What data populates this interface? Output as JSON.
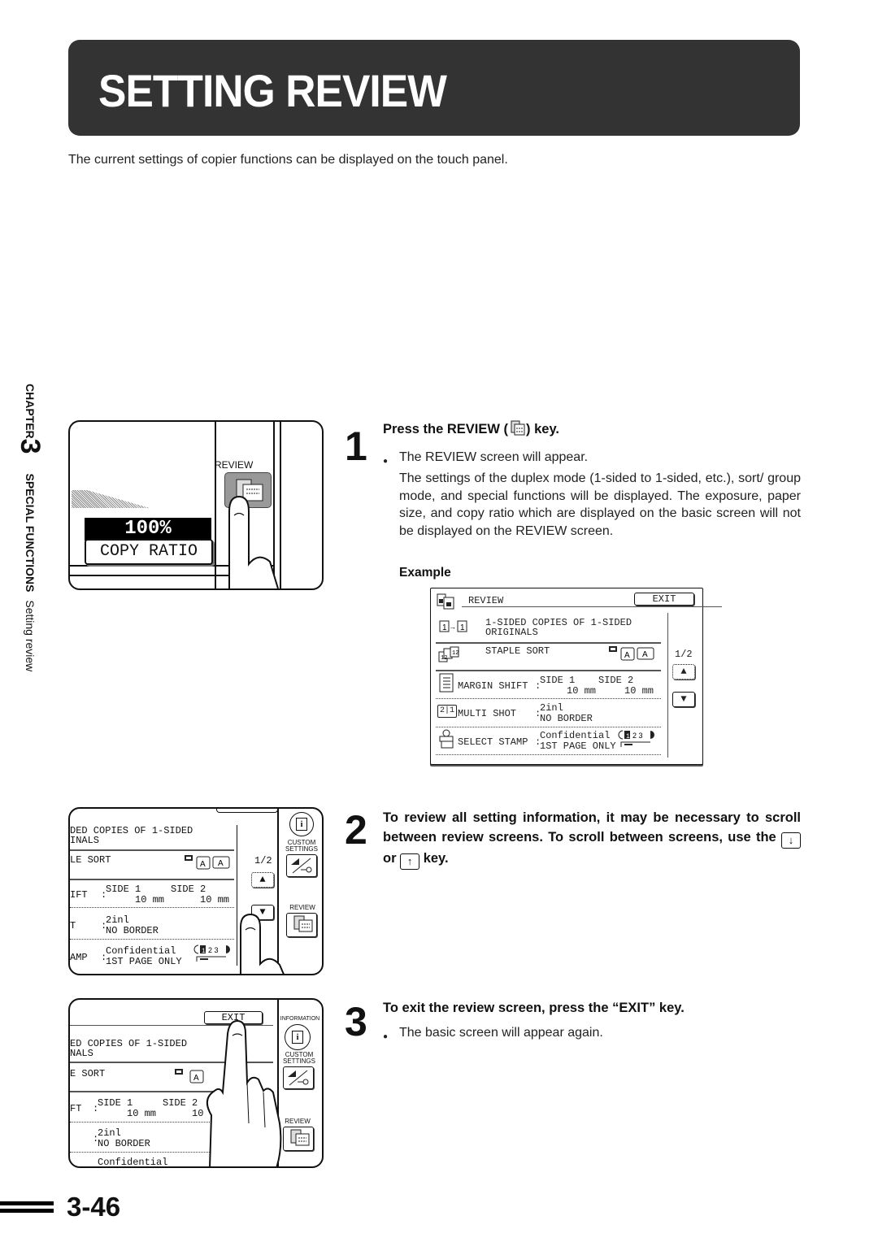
{
  "page": {
    "title": "SETTING REVIEW",
    "intro": "The current settings of copier functions can be displayed on the touch panel.",
    "side_label": {
      "chapter": "CHAPTER",
      "chapter_number": "3",
      "section": "SPECIAL FUNCTIONS",
      "subsection": "Setting review"
    },
    "page_number": "3-46"
  },
  "panel1": {
    "review_label": "REVIEW",
    "ratio_value": "100%",
    "ratio_label": "COPY RATIO",
    "review_icon": "review-key-icon"
  },
  "step1": {
    "number": "1",
    "heading_pre": "Press the REVIEW (",
    "heading_post": ") key.",
    "bullet": "The REVIEW screen will appear.",
    "paragraph": "The settings of the duplex mode (1-sided to 1-sided, etc.), sort/ group mode, and special functions will be displayed. The exposure, paper size, and copy ratio which are displayed on the basic screen will not be displayed on the REVIEW screen.",
    "example_label": "Example"
  },
  "example_screen": {
    "title": "REVIEW",
    "exit_label": "EXIT",
    "page_indicator": "1/2",
    "rows": [
      {
        "icon": "duplex-1-to-1-icon",
        "line1": "1-SIDED COPIES OF 1-SIDED",
        "line2": "ORIGINALS"
      },
      {
        "icon": "staple-sort-icon",
        "line1": "STAPLE SORT",
        "line2": ""
      },
      {
        "icon": "margin-shift-icon",
        "label": "MARGIN SHIFT",
        "side1": "SIDE 1",
        "side1_val": "10 mm",
        "side2": "SIDE 2",
        "side2_val": "10 mm"
      },
      {
        "icon": "multi-shot-icon",
        "label": "MULTI SHOT",
        "line1": "2inl",
        "line2": "NO BORDER"
      },
      {
        "icon": "select-stamp-icon",
        "label": "SELECT STAMP",
        "line1": "Confidential",
        "line2": "1ST PAGE ONLY",
        "stamp_pages": "1 2 3"
      }
    ],
    "multishot_digits": "2|1"
  },
  "step2": {
    "number": "2",
    "heading_pre": "To review all setting information, it may be necessary to scroll between review screens. To scroll between screens, use the",
    "heading_mid": "or",
    "heading_post": "key.",
    "down_key": "↓",
    "up_key": "↑"
  },
  "panel2": {
    "line1": "DED COPIES OF 1-SIDED",
    "line2": "INALS",
    "sort": "LE SORT",
    "shift_label": "IFT",
    "side1": "SIDE 1",
    "side1_val": "10 mm",
    "side2": "SIDE 2",
    "side2_val": "10 mm",
    "ms_label": "T",
    "ms1": "2inl",
    "ms2": "NO BORDER",
    "stamp_label": "AMP",
    "stamp1": "Confidential",
    "stamp2": "1ST PAGE ONLY",
    "page_indicator": "1/2",
    "custom_settings": "CUSTOM SETTINGS",
    "review": "REVIEW"
  },
  "step3": {
    "number": "3",
    "heading": "To exit the review screen, press the “EXIT” key.",
    "bullet": "The basic screen will appear again."
  },
  "panel3": {
    "exit_label": "EXIT",
    "line1": "ED COPIES OF 1-SIDED",
    "line2": "NALS",
    "sort": "E SORT",
    "shift_label": "FT",
    "side1": "SIDE 1",
    "side1_val": "10 mm",
    "side2": "SIDE 2",
    "side2_val": "10",
    "ms1": "2inl",
    "ms2": "NO BORDER",
    "stamp1": "Confidential",
    "information": "INFORMATION",
    "custom_settings": "CUSTOM SETTINGS",
    "review": "REVIEW"
  }
}
